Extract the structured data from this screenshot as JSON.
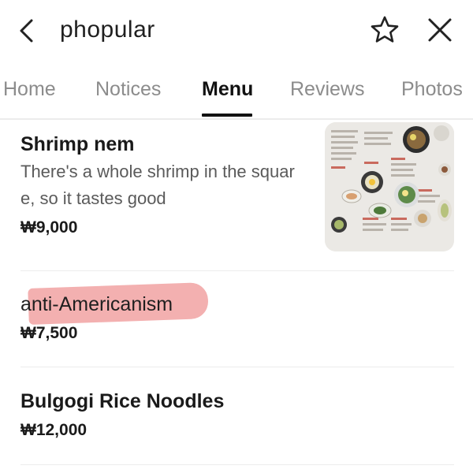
{
  "header": {
    "title": "phopular",
    "back_icon": "chevron-left-icon",
    "favorite_icon": "star-outline-icon",
    "close_icon": "close-icon"
  },
  "tabs": [
    {
      "label": "Home",
      "active": false
    },
    {
      "label": "Notices",
      "active": false
    },
    {
      "label": "Menu",
      "active": true
    },
    {
      "label": "Reviews",
      "active": false
    },
    {
      "label": "Photos",
      "active": false
    }
  ],
  "menu": {
    "items": [
      {
        "name": "Shrimp nem",
        "description": "There's a whole shrimp in the square, so it tastes good",
        "price": "₩9,000",
        "has_image": true
      },
      {
        "name": "anti-Americanism",
        "price": "₩7,500",
        "highlight_color": "#f09c9c"
      },
      {
        "name": "Bulgogi Rice Noodles",
        "price": "₩12,000"
      }
    ]
  },
  "colors": {
    "active_tab": "#111111",
    "inactive_tab": "#8c8c8c",
    "divider": "#ececec",
    "highlight": "#f09c9c"
  }
}
